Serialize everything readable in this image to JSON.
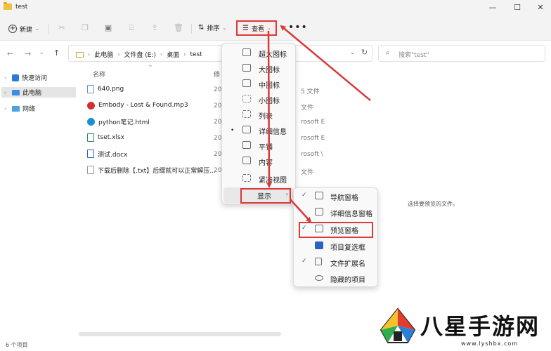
{
  "window": {
    "title": "test",
    "minimize_glyph": "—",
    "maximize_glyph": "☐",
    "close_glyph": "✕"
  },
  "toolbar": {
    "new_label": "新建",
    "sort_label": "排序",
    "view_label": "查看",
    "more_label": "•••",
    "icons": [
      "cut-icon",
      "copy-icon",
      "paste-icon",
      "rename-icon",
      "share-icon",
      "delete-icon"
    ]
  },
  "nav": {
    "breadcrumb": [
      "此电脑",
      "文件盘 (E:)",
      "桌面",
      "test"
    ],
    "search_placeholder": "搜索\"test\""
  },
  "sidebar": {
    "items": [
      {
        "label": "快速访问",
        "icon": "star-icon"
      },
      {
        "label": "此电脑",
        "icon": "pc-icon"
      },
      {
        "label": "网络",
        "icon": "network-icon"
      }
    ]
  },
  "columns": {
    "name": "名称",
    "date": "修"
  },
  "files": [
    {
      "name": "640.png",
      "date": "20",
      "type": "5 文件",
      "icon": "image-file-icon"
    },
    {
      "name": "Embody - Lost & Found.mp3",
      "date": "20",
      "type": "文件",
      "icon": "audio-file-icon"
    },
    {
      "name": "python笔记.html",
      "date": "20",
      "type": "rosoft E",
      "icon": "edge-file-icon"
    },
    {
      "name": "tset.xlsx",
      "date": "20",
      "type": "rosoft E",
      "icon": "excel-file-icon"
    },
    {
      "name": "测试.docx",
      "date": "20",
      "type": "rosoft \\",
      "icon": "word-file-icon"
    },
    {
      "name": "下载后删除【.txt】后缀就可以正常解压...",
      "date": "20",
      "type": "文件",
      "icon": "text-file-icon"
    }
  ],
  "view_menu": {
    "items": [
      {
        "label": "超大图标",
        "selected": false
      },
      {
        "label": "大图标",
        "selected": false
      },
      {
        "label": "中图标",
        "selected": false
      },
      {
        "label": "小图标",
        "selected": false
      },
      {
        "label": "列表",
        "selected": false
      },
      {
        "label": "详细信息",
        "selected": true
      },
      {
        "label": "平铺",
        "selected": false
      },
      {
        "label": "内容",
        "selected": false
      },
      {
        "label": "紧凑视图",
        "selected": false
      }
    ],
    "show_label": "显示"
  },
  "show_menu": {
    "items": [
      {
        "label": "导航窗格",
        "checked": true
      },
      {
        "label": "详细信息窗格",
        "checked": false
      },
      {
        "label": "预览窗格",
        "checked": true
      },
      {
        "label": "项目复选框",
        "checked": false
      },
      {
        "label": "文件扩展名",
        "checked": true
      },
      {
        "label": "隐藏的项目",
        "checked": false
      }
    ]
  },
  "preview_message": "选择要预览的文件。",
  "status": {
    "item_count": "6 个项目"
  },
  "watermark": {
    "text": "八星手游网",
    "url": "www.lyshbx.com"
  },
  "colors": {
    "highlight_red": "#d93a3a",
    "accent_blue": "#2a63c4"
  }
}
